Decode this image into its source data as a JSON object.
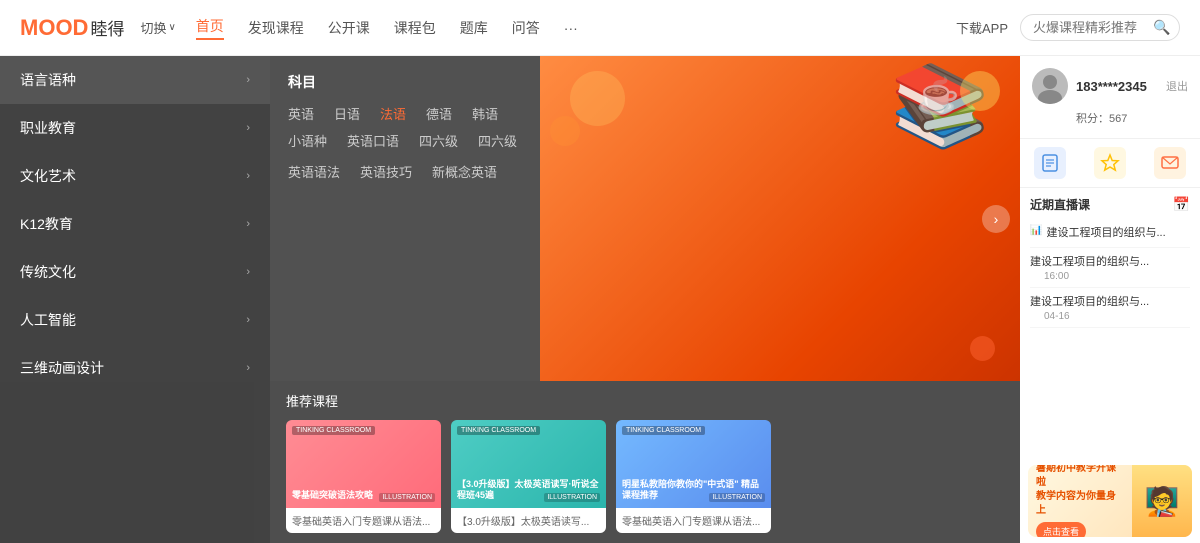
{
  "header": {
    "logo_text": "MOOD",
    "logo_cn": "睦得",
    "switch_label": "切换",
    "nav_items": [
      {
        "label": "首页",
        "active": true
      },
      {
        "label": "发现课程",
        "active": false
      },
      {
        "label": "公开课",
        "active": false
      },
      {
        "label": "课程包",
        "active": false
      },
      {
        "label": "题库",
        "active": false
      },
      {
        "label": "问答",
        "active": false
      },
      {
        "label": "···",
        "active": false
      }
    ],
    "download_label": "下载APP",
    "search_placeholder": "火爆课程精彩推荐"
  },
  "sidebar": {
    "items": [
      {
        "label": "语言语种",
        "has_arrow": true,
        "active": true
      },
      {
        "label": "职业教育",
        "has_arrow": true
      },
      {
        "label": "文化艺术",
        "has_arrow": true
      },
      {
        "label": "K12教育",
        "has_arrow": true
      },
      {
        "label": "传统文化",
        "has_arrow": true
      },
      {
        "label": "人工智能",
        "has_arrow": true
      },
      {
        "label": "三维动画设计",
        "has_arrow": true
      }
    ]
  },
  "subject": {
    "title": "科目",
    "tags": [
      {
        "label": "英语",
        "highlight": false
      },
      {
        "label": "日语",
        "highlight": false
      },
      {
        "label": "法语",
        "highlight": true
      },
      {
        "label": "德语",
        "highlight": false
      },
      {
        "label": "韩语",
        "highlight": false
      },
      {
        "label": "小语种",
        "highlight": false
      },
      {
        "label": "英语口语",
        "highlight": false
      },
      {
        "label": "四六级",
        "highlight": false
      },
      {
        "label": "四六级",
        "highlight": false
      },
      {
        "label": "英语语法",
        "highlight": false
      },
      {
        "label": "英语技巧",
        "highlight": false
      },
      {
        "label": "新概念英语",
        "highlight": false
      }
    ]
  },
  "recommended": {
    "title": "推荐课程",
    "courses": [
      {
        "type": "pink",
        "card_label": "TINKING CLASSROOM",
        "title": "零基础突破语法攻略",
        "bottom_text": "零基础英语入门专题课从语法...",
        "illustration": "ILLUSTRATION"
      },
      {
        "type": "teal",
        "card_label": "TINKING CLASSROOM",
        "title": "【3.0升级版】太极英语读写·听说全程班45遍",
        "bottom_text": "【3.0升级版】太极英语读写...",
        "illustration": "ILLUSTRATION"
      },
      {
        "type": "blue",
        "card_label": "TINKING CLASSROOM",
        "title": "明星私教陪你教你的\"中式语\" 精品课程推荐",
        "bottom_text": "零基础英语入门专题课从语法...",
        "illustration": "ILLUSTRATION"
      }
    ]
  },
  "user": {
    "name": "183****2345",
    "logout_label": "退出",
    "score_label": "积分：567",
    "actions": [
      {
        "icon": "📋",
        "color": "blue"
      },
      {
        "icon": "⭐",
        "color": "yellow"
      },
      {
        "icon": "💬",
        "color": "orange"
      }
    ]
  },
  "live": {
    "title": "近期直播课",
    "items": [
      {
        "name": "建设工程项目的组织与...",
        "time": null
      },
      {
        "name": "建设工程项目的组织与...",
        "time": "16:00"
      },
      {
        "name": "建设工程项目的组织与...",
        "time": "04-16"
      }
    ]
  },
  "ad": {
    "title": "暑期初中教学开课啦\n教学内容为你量身上",
    "btn_label": "点击查看"
  },
  "icons": {
    "arrow_right": "›",
    "arrow_left": "‹",
    "search": "🔍",
    "chevron_down": "∨",
    "calendar": "📅",
    "bar_chart": "📊"
  }
}
